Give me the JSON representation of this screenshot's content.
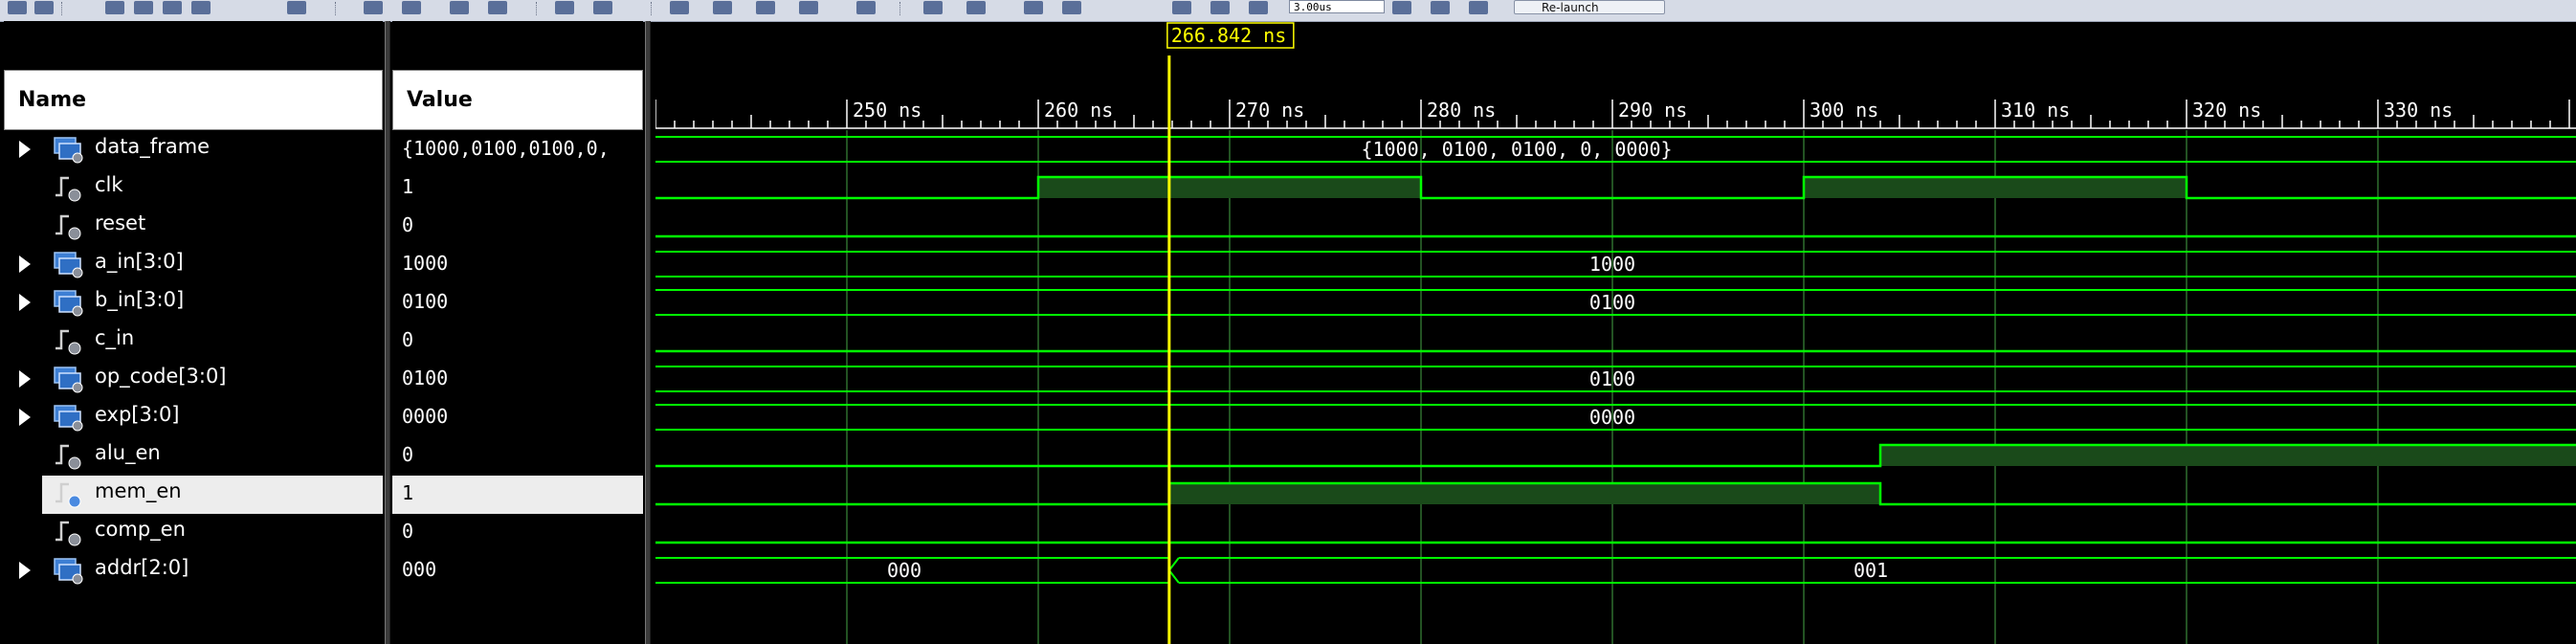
{
  "toolbar": {
    "time_field": "3.00us",
    "relaunch_label": "Re-launch"
  },
  "cursor_readout": "266.842 ns",
  "headers": {
    "name": "Name",
    "value": "Value"
  },
  "signals": [
    {
      "name": "data_frame",
      "value": "{1000,0100,0100,0,",
      "type": "bus",
      "expandable": true,
      "wave_label": "{1000, 0100, 0100, 0, 0000}"
    },
    {
      "name": "clk",
      "value": "1",
      "type": "bit",
      "expandable": false
    },
    {
      "name": "reset",
      "value": "0",
      "type": "bit",
      "expandable": false
    },
    {
      "name": "a_in[3:0]",
      "value": "1000",
      "type": "bus",
      "expandable": true,
      "wave_label": "1000"
    },
    {
      "name": "b_in[3:0]",
      "value": "0100",
      "type": "bus",
      "expandable": true,
      "wave_label": "0100"
    },
    {
      "name": "c_in",
      "value": "0",
      "type": "bit",
      "expandable": false
    },
    {
      "name": "op_code[3:0]",
      "value": "0100",
      "type": "bus",
      "expandable": true,
      "wave_label": "0100"
    },
    {
      "name": "exp[3:0]",
      "value": "0000",
      "type": "bus",
      "expandable": true,
      "wave_label": "0000"
    },
    {
      "name": "alu_en",
      "value": "0",
      "type": "bit",
      "expandable": false
    },
    {
      "name": "mem_en",
      "value": "1",
      "type": "bit",
      "expandable": false,
      "selected": true
    },
    {
      "name": "comp_en",
      "value": "0",
      "type": "bit",
      "expandable": false
    },
    {
      "name": "addr[2:0]",
      "value": "000",
      "type": "bus",
      "expandable": true,
      "wave_labels": [
        "000",
        "001"
      ]
    }
  ],
  "timeline": {
    "ticks": [
      "250 ns",
      "260 ns",
      "270 ns",
      "280 ns",
      "290 ns",
      "300 ns",
      "310 ns",
      "320 ns",
      "330 ns"
    ],
    "cursor_ns": 266.842,
    "clk_high": [
      [
        260,
        280
      ],
      [
        300,
        320
      ]
    ],
    "alu_en_rise_ns": 304,
    "mem_en_high": [
      266.842,
      304
    ],
    "addr_change_ns": 266.842
  },
  "colors": {
    "wave": "#00ff00",
    "cursor": "#ffff00",
    "fill_high": "#1a4a1a",
    "grid": "#2f6f2f"
  }
}
